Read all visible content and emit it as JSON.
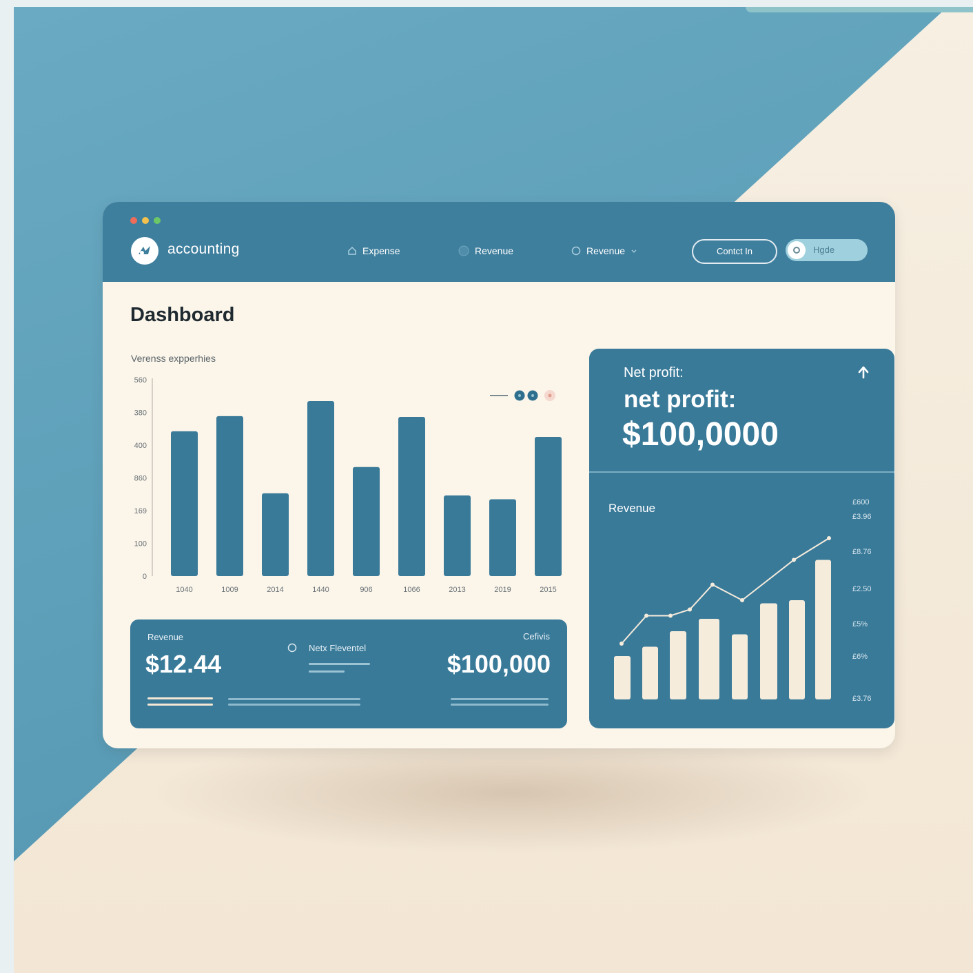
{
  "colors": {
    "primary": "#3f7f9e",
    "card": "#3a7a99",
    "cream": "#fbf5ea",
    "accent_cream": "#f4e8d4"
  },
  "window_controls": [
    "#ef6c5b",
    "#f2c14e",
    "#6cc766"
  ],
  "header": {
    "brand": "accounting",
    "nav": [
      {
        "label": "Expense",
        "icon": "home-icon"
      },
      {
        "label": "Revenue",
        "icon": "circle-icon"
      },
      {
        "label": "Revenue",
        "icon": "circle-outline-icon",
        "dropdown": true
      }
    ],
    "outline_button": "Contct In",
    "pill_button": "Hgde"
  },
  "page_title": "Dashboard",
  "expenses_chart": {
    "subtitle": "Verenss expperhies",
    "legend": [
      "—",
      "●●",
      "●"
    ]
  },
  "chart_data": [
    {
      "type": "bar",
      "title": "Verenss expperhies",
      "y_tick_labels": [
        "0",
        "100",
        "169",
        "860",
        "400",
        "380",
        "560"
      ],
      "categories": [
        "1040",
        "1009",
        "2014",
        "1440",
        "906",
        "1066",
        "2013",
        "2019",
        "2015"
      ],
      "values": [
        413,
        456,
        236,
        499,
        311,
        454,
        230,
        219,
        397
      ],
      "ylim": [
        0,
        560
      ],
      "grid": false
    },
    {
      "type": "bar",
      "title": "Revenue",
      "y_tick_labels": [
        "£600",
        "£3.96",
        "£8.76",
        "£2.50",
        "£5%",
        "£6%",
        "£3.76"
      ],
      "bars": [
        14,
        17,
        22,
        26,
        21,
        31,
        32,
        45
      ],
      "line": [
        18,
        27,
        27,
        29,
        37,
        32,
        45,
        52
      ],
      "grid": false
    }
  ],
  "bottom_card": {
    "revenue_label": "Revenue",
    "revenue_value": "$12.44",
    "middle_label": "Netx Fleventel",
    "right_label": "Cefivis",
    "right_value": "$100,000"
  },
  "profit_card": {
    "label_small": "Net profit:",
    "label_big": "net profit:",
    "value": "$100,0000",
    "revenue_label": "Revenue"
  }
}
